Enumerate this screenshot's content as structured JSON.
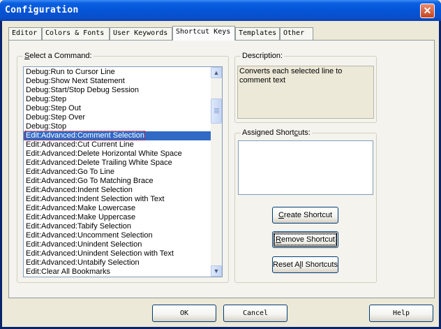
{
  "window": {
    "title": "Configuration"
  },
  "tabs": [
    {
      "label": "Editor"
    },
    {
      "label": "Colors & Fonts"
    },
    {
      "label": "User Keywords"
    },
    {
      "label": "Shortcut Keys"
    },
    {
      "label": "Templates"
    },
    {
      "label": "Other"
    }
  ],
  "command_group": {
    "label_prefix": "",
    "label_hotkey": "S",
    "label_rest": "elect a Command:",
    "items": [
      "Debug:Run to Cursor Line",
      "Debug:Show Next Statement",
      "Debug:Start/Stop Debug Session",
      "Debug:Step",
      "Debug:Step Out",
      "Debug:Step Over",
      "Debug:Stop",
      "Edit:Advanced:Comment Selection",
      "Edit:Advanced:Cut Current Line",
      "Edit:Advanced:Delete Horizontal White Space",
      "Edit:Advanced:Delete Trailing White Space",
      "Edit:Advanced:Go To Line",
      "Edit:Advanced:Go To Matching Brace",
      "Edit:Advanced:Indent Selection",
      "Edit:Advanced:Indent Selection with Text",
      "Edit:Advanced:Make Lowercase",
      "Edit:Advanced:Make Uppercase",
      "Edit:Advanced:Tabify Selection",
      "Edit:Advanced:Uncomment Selection",
      "Edit:Advanced:Unindent Selection",
      "Edit:Advanced:Unindent Selection with Text",
      "Edit:Advanced:Untabify Selection",
      "Edit:Clear All Bookmarks"
    ],
    "selected_item": "Edit:Advanced:Comment Selection"
  },
  "description_group": {
    "label": "Description:",
    "text": "Converts each selected line to comment text"
  },
  "shortcuts_group": {
    "label_pre": "Assigned Short",
    "label_hotkey": "c",
    "label_post": "uts:",
    "value": ""
  },
  "buttons": {
    "create_pre": "",
    "create_hotkey": "C",
    "create_post": "reate Shortcut",
    "remove_pre": "",
    "remove_hotkey": "R",
    "remove_post": "emove Shortcut",
    "reset_pre": "Reset A",
    "reset_hotkey": "l",
    "reset_post": "l Shortcuts",
    "ok": "OK",
    "cancel": "Cancel",
    "help": "Help"
  },
  "icons": {
    "close": "close-icon",
    "scroll_up": "arrow-up-icon",
    "scroll_down": "arrow-down-icon"
  }
}
